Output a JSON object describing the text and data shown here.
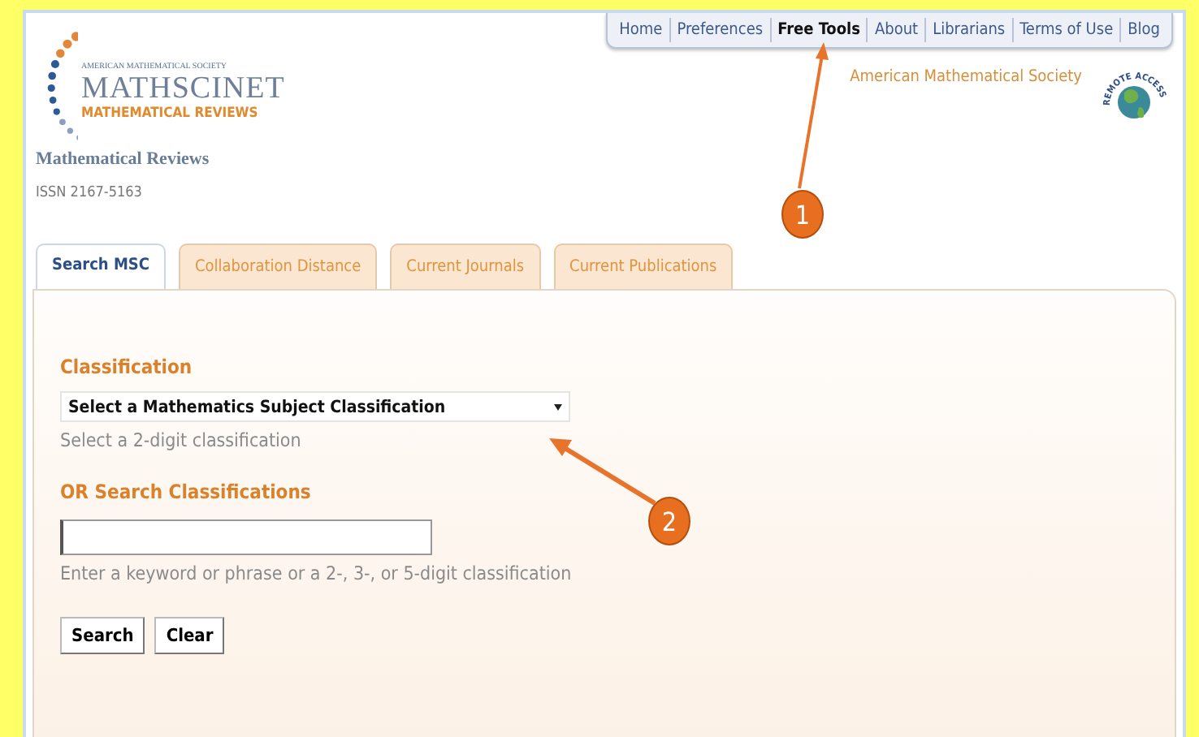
{
  "nav": [
    {
      "label": "Home",
      "selected": false
    },
    {
      "label": "Preferences",
      "selected": false
    },
    {
      "label": "Free Tools",
      "selected": true
    },
    {
      "label": "About",
      "selected": false
    },
    {
      "label": "Librarians",
      "selected": false
    },
    {
      "label": "Terms of Use",
      "selected": false
    },
    {
      "label": "Blog",
      "selected": false
    }
  ],
  "logo": {
    "society": "AMERICAN MATHEMATICAL SOCIETY",
    "name": "MATHSCINET",
    "subtitle": "MATHEMATICAL REVIEWS"
  },
  "heading": "Mathematical Reviews",
  "issn": "ISSN 2167-5163",
  "org_link": "American Mathematical Society",
  "remote_badge": "REMOTE ACCESS",
  "tabs": [
    {
      "label": "Search MSC",
      "selected": true
    },
    {
      "label": "Collaboration Distance",
      "selected": false
    },
    {
      "label": "Current Journals",
      "selected": false
    },
    {
      "label": "Current Publications",
      "selected": false
    }
  ],
  "form": {
    "classification_label": "Classification",
    "select_value": "Select a Mathematics Subject Classification",
    "select_hint": "Select a 2-digit classification",
    "search_label": "OR Search Classifications",
    "search_hint": "Enter a keyword or phrase or a 2-, 3-, or 5-digit classification",
    "buttons": [
      "Search",
      "Clear"
    ]
  },
  "callouts": [
    "1",
    "2"
  ]
}
